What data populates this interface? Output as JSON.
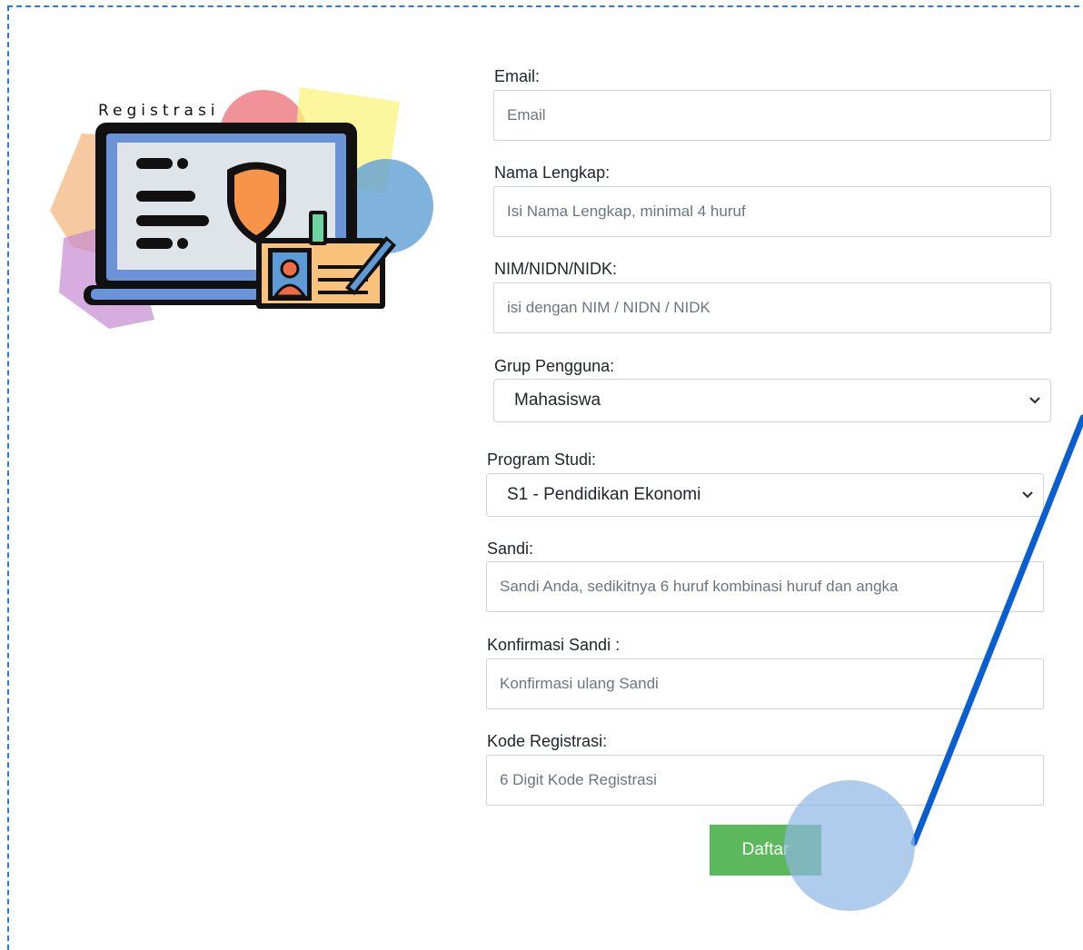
{
  "illustration": {
    "caption": "Registrasi"
  },
  "form": {
    "email": {
      "label": "Email:",
      "placeholder": "Email"
    },
    "nama": {
      "label": "Nama Lengkap:",
      "placeholder": "Isi Nama Lengkap, minimal 4 huruf"
    },
    "nim": {
      "label": "NIM/NIDN/NIDK:",
      "placeholder": "isi dengan NIM / NIDN / NIDK"
    },
    "grup": {
      "label": "Grup Pengguna:",
      "selected": "Mahasiswa"
    },
    "prodi": {
      "label": "Program Studi:",
      "selected": "S1 - Pendidikan Ekonomi"
    },
    "sandi": {
      "label": "Sandi:",
      "placeholder": "Sandi Anda, sedikitnya 6 huruf kombinasi huruf dan angka"
    },
    "konfirmasi": {
      "label": "Konfirmasi Sandi :",
      "placeholder": "Konfirmasi ulang Sandi"
    },
    "kode": {
      "label": "Kode Registrasi:",
      "placeholder": "6 Digit Kode Registrasi"
    },
    "submit_label": "Daftar"
  },
  "colors": {
    "accent_button": "#5cb85c",
    "annotation_arrow": "#0a5fd0",
    "annotation_circle": "#8fb6e6",
    "frame_border": "#2a7bd8"
  }
}
